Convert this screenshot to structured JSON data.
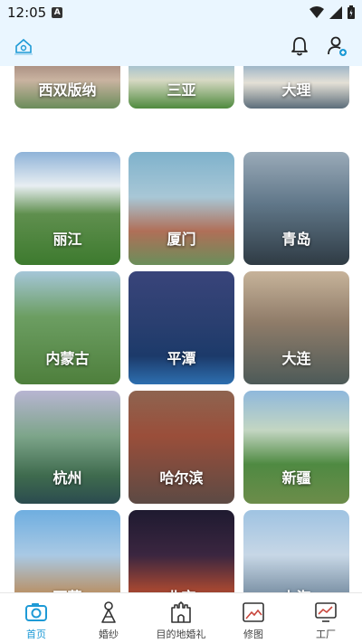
{
  "status_bar": {
    "time": "12:05",
    "notification_badge": "A"
  },
  "colors": {
    "accent": "#1e9ad6",
    "header_bg": "#eaf6ff"
  },
  "header": {
    "logo_icon": "logo-icon",
    "bell_icon": "bell-icon",
    "user_add_icon": "user-add-icon"
  },
  "destinations": [
    {
      "label": "西双版纳"
    },
    {
      "label": "三亚"
    },
    {
      "label": "大理"
    },
    {
      "label": "丽江"
    },
    {
      "label": "厦门"
    },
    {
      "label": "青岛"
    },
    {
      "label": "内蒙古"
    },
    {
      "label": "平潭"
    },
    {
      "label": "大连"
    },
    {
      "label": "杭州"
    },
    {
      "label": "哈尔滨"
    },
    {
      "label": "新疆"
    },
    {
      "label": "西藏"
    },
    {
      "label": "北京"
    },
    {
      "label": "上海"
    }
  ],
  "bottom_nav": {
    "items": [
      {
        "label": "首页",
        "icon": "camera-icon",
        "active": true
      },
      {
        "label": "婚纱",
        "icon": "bride-icon",
        "active": false
      },
      {
        "label": "目的地婚礼",
        "icon": "castle-icon",
        "active": false
      },
      {
        "label": "修图",
        "icon": "photo-edit-icon",
        "active": false
      },
      {
        "label": "工厂",
        "icon": "monitor-icon",
        "active": false
      }
    ]
  }
}
